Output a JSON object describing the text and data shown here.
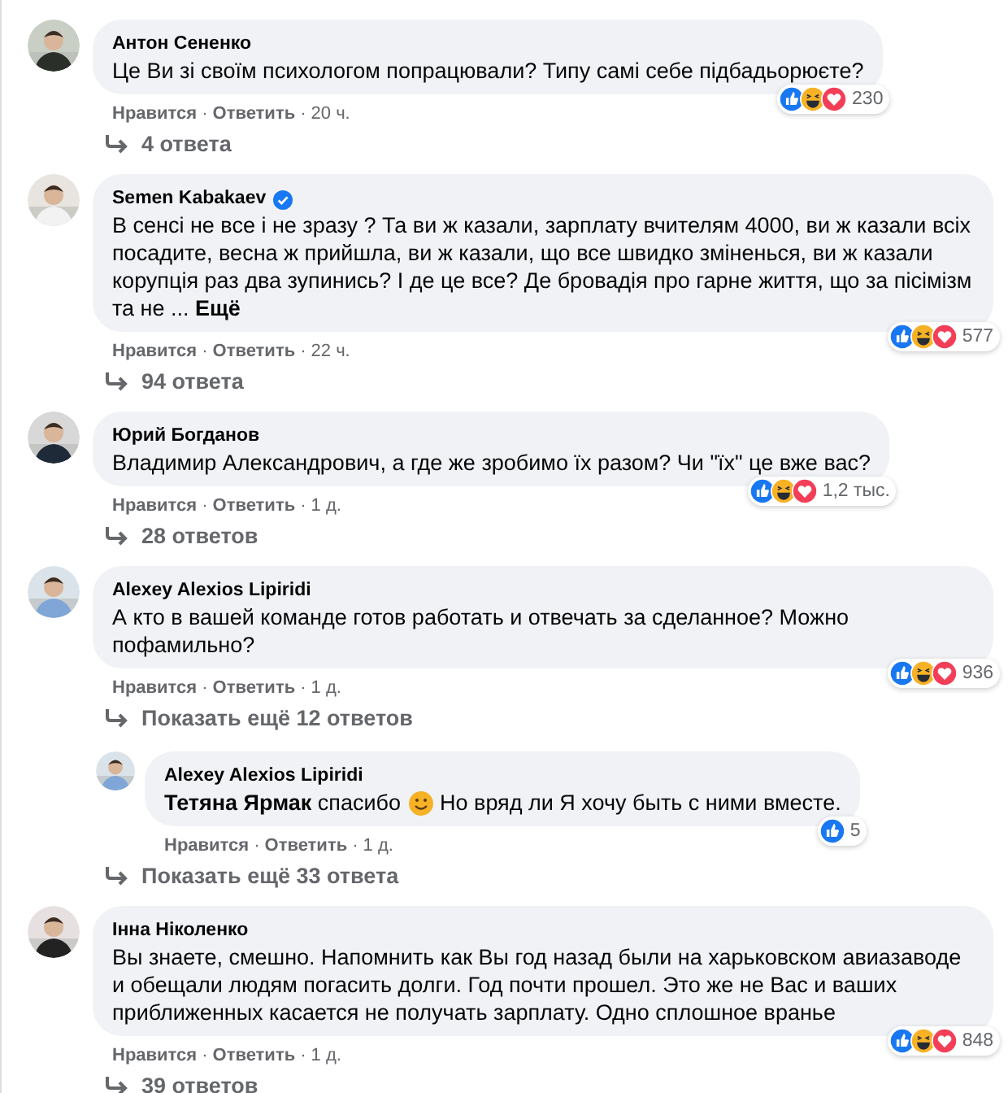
{
  "comments": [
    {
      "author": "Антон Сененко",
      "verified": false,
      "text": "Це Ви зі своїм психологом попрацювали? Типу самі себе підбадьорюєте?",
      "actions": [
        "Нравится",
        "·",
        "Ответить",
        "·"
      ],
      "time": "20 ч.",
      "count": "230",
      "replies_link": "4 ответа"
    },
    {
      "author": "Semen Kabakaev",
      "verified": true,
      "text": "В сенсі не все і не зразу ? Та ви ж казали, зарплату вчителям 4000, ви ж казали всіх посадите, весна ж прийшла, ви ж казали, що все швидко зміненься, ви ж казали корупція раз два зупинись? І де це все? Де бровадія про гарне життя, що за пісімізм та не ...",
      "more": "Ещё",
      "actions": [
        "Нравится",
        "·",
        "Ответить",
        "·"
      ],
      "time": "22 ч.",
      "count": "577",
      "replies_link": "94 ответа"
    },
    {
      "author": "Юрий Богданов",
      "verified": false,
      "text": "Владимир Александрович, а где же зробимо їх разом? Чи \"їх\" це вже вас?",
      "actions": [
        "Нравится",
        "·",
        "Ответить",
        "·"
      ],
      "time": "1 д.",
      "count": "1,2 тыс.",
      "replies_link": "28 ответов"
    },
    {
      "author": "Alexey Alexios Lipiridi",
      "verified": false,
      "text": "А кто в вашей команде готов работать и отвечать за сделанное? Можно пофамильно?",
      "actions": [
        "Нравится",
        "·",
        "Ответить",
        "·"
      ],
      "time": "1 д.",
      "count": "936",
      "replies_link": "Показать ещё 12 ответов",
      "children": [
        {
          "author": "Alexey Alexios Lipiridi",
          "verified": false,
          "text": "**Тетяна Ярмак** спасибо",
          "text_after": "Но вряд ли Я хочу быть с ними вместе.",
          "actions": [
            "Нравится",
            "·",
            "Ответить",
            "·"
          ],
          "time": "1 д.",
          "count": "5"
        }
      ],
      "more_link": "Показать ещё 33 ответа"
    },
    {
      "author": "Інна Ніколенко",
      "verified": false,
      "text": "Вы знаете, смешно. Напомнить как Вы год назад были на харьковском авиазаводе и обещали людям погасить долги. Год почти прошел. Это же не Вас и ваших приближенных касается не получать зарплату. Одно сплошное вранье",
      "actions": [
        "Нравится",
        "·",
        "Ответить",
        "·"
      ],
      "time": "1 д.",
      "count": "848",
      "replies_link": "39 ответов"
    }
  ]
}
